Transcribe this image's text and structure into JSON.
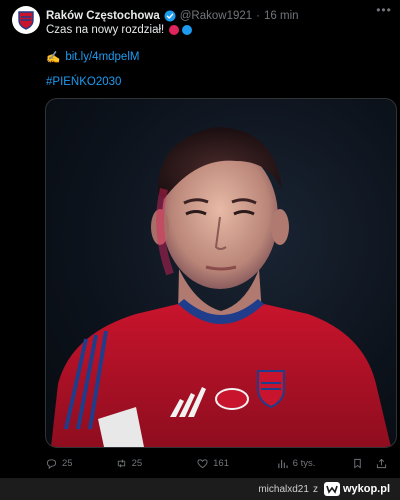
{
  "tweet": {
    "author_name": "Raków Częstochowa",
    "handle": "@Rakow1921",
    "separator": "·",
    "time": "16 min",
    "text": "Czas na nowy rozdział!",
    "link_emoji": "✍️",
    "link": "bit.ly/4mdpelM",
    "hashtag": "#PIEŃKO2030",
    "dot_colors": [
      "#e0245e",
      "#1d9bf0"
    ],
    "media_alt_icon": "player-photo",
    "actions": {
      "replies": "25",
      "retweets": "25",
      "likes": "161",
      "views": "6 tys."
    }
  },
  "footer": {
    "user": "michalxd21",
    "z": "z",
    "site": "wykop.pl"
  },
  "colors": {
    "background": "#000000",
    "accent": "#1d9bf0",
    "muted": "#71767b",
    "jersey": "#c8142c"
  }
}
